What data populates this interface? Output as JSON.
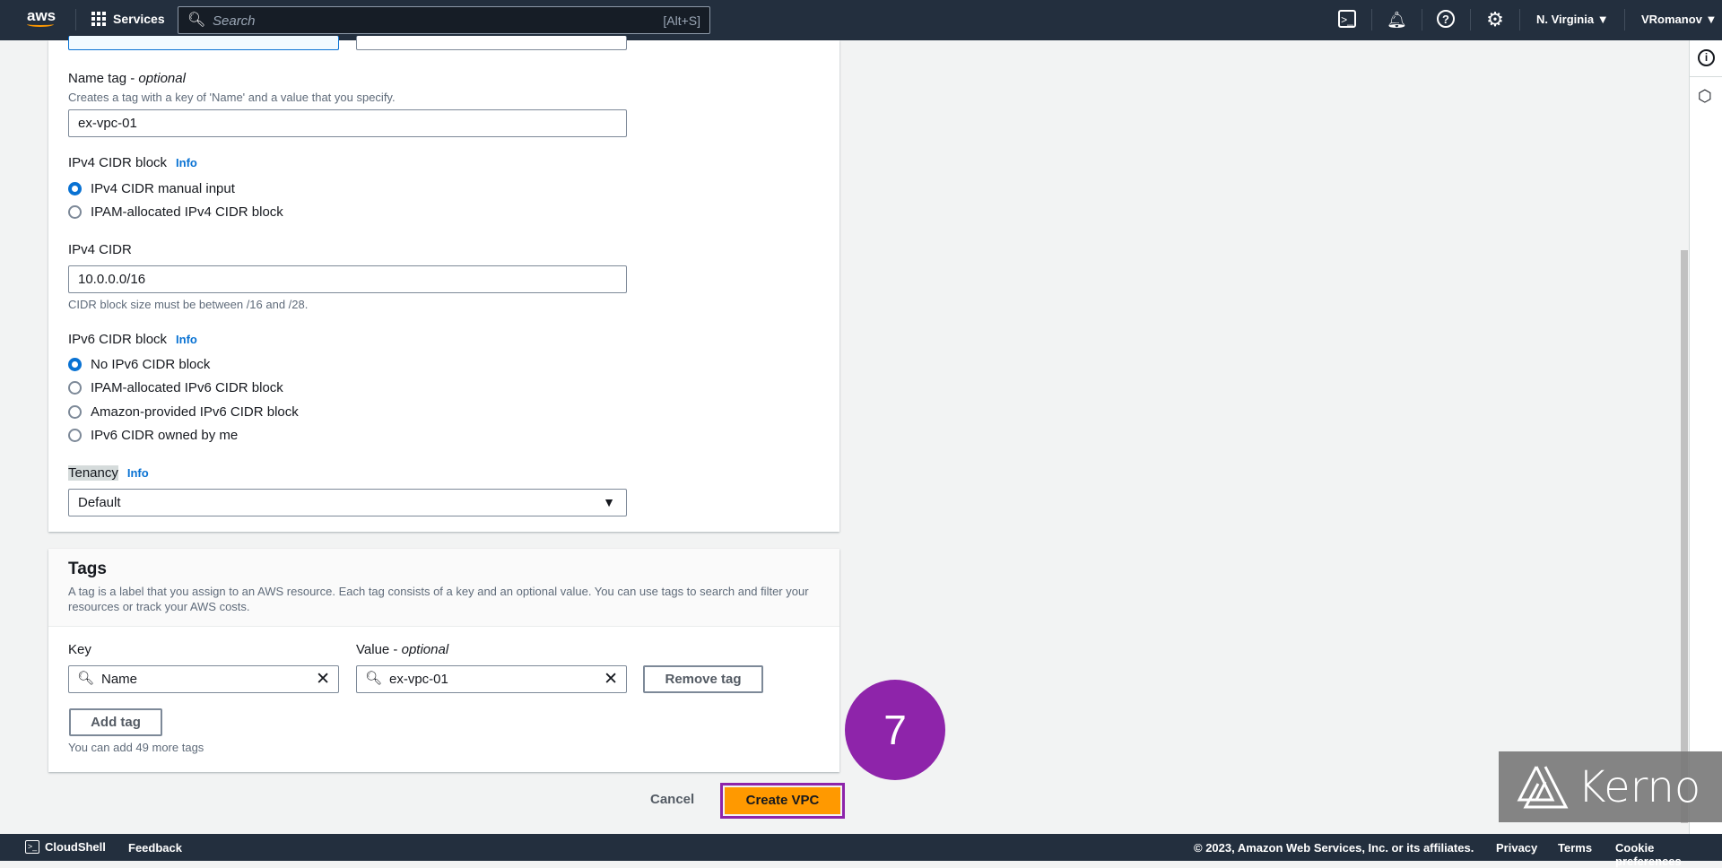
{
  "topbar": {
    "logo": "aws",
    "services": "Services",
    "search_placeholder": "Search",
    "search_shortcut": "[Alt+S]",
    "region": "N. Virginia",
    "user": "VRomanov",
    "icons": [
      "cloudshell-icon",
      "bell-icon",
      "help-icon",
      "gear-icon"
    ]
  },
  "form": {
    "name_tag": {
      "label": "Name tag",
      "optional": "optional",
      "hint": "Creates a tag with a key of 'Name' and a value that you specify.",
      "value": "ex-vpc-01"
    },
    "ipv4_block": {
      "label": "IPv4 CIDR block",
      "info": "Info",
      "options": [
        {
          "label": "IPv4 CIDR manual input",
          "selected": true
        },
        {
          "label": "IPAM-allocated IPv4 CIDR block",
          "selected": false
        }
      ]
    },
    "ipv4_cidr": {
      "label": "IPv4 CIDR",
      "value": "10.0.0.0/16",
      "hint": "CIDR block size must be between /16 and /28."
    },
    "ipv6_block": {
      "label": "IPv6 CIDR block",
      "info": "Info",
      "options": [
        {
          "label": "No IPv6 CIDR block",
          "selected": true
        },
        {
          "label": "IPAM-allocated IPv6 CIDR block",
          "selected": false
        },
        {
          "label": "Amazon-provided IPv6 CIDR block",
          "selected": false
        },
        {
          "label": "IPv6 CIDR owned by me",
          "selected": false
        }
      ]
    },
    "tenancy": {
      "label": "Tenancy",
      "info": "Info",
      "value": "Default"
    }
  },
  "tags": {
    "title": "Tags",
    "description": "A tag is a label that you assign to an AWS resource. Each tag consists of a key and an optional value. You can use tags to search and filter your resources or track your AWS costs.",
    "key_label": "Key",
    "value_label": "Value",
    "value_optional": "optional",
    "key": "Name",
    "value": "ex-vpc-01",
    "remove": "Remove tag",
    "add": "Add tag",
    "hint": "You can add 49 more tags"
  },
  "actions": {
    "cancel": "Cancel",
    "create": "Create VPC"
  },
  "step": {
    "number": "7",
    "color": "#8e24aa"
  },
  "watermark": {
    "text": "Kerno"
  },
  "footer": {
    "cloudshell": "CloudShell",
    "feedback": "Feedback",
    "copyright": "© 2023, Amazon Web Services, Inc. or its affiliates.",
    "privacy": "Privacy",
    "terms": "Terms",
    "cookies": "Cookie preferences"
  },
  "colors": {
    "accent": "#0972d3",
    "primary_button": "#ff9900",
    "highlight": "#8e24aa",
    "nav": "#232f3e"
  }
}
